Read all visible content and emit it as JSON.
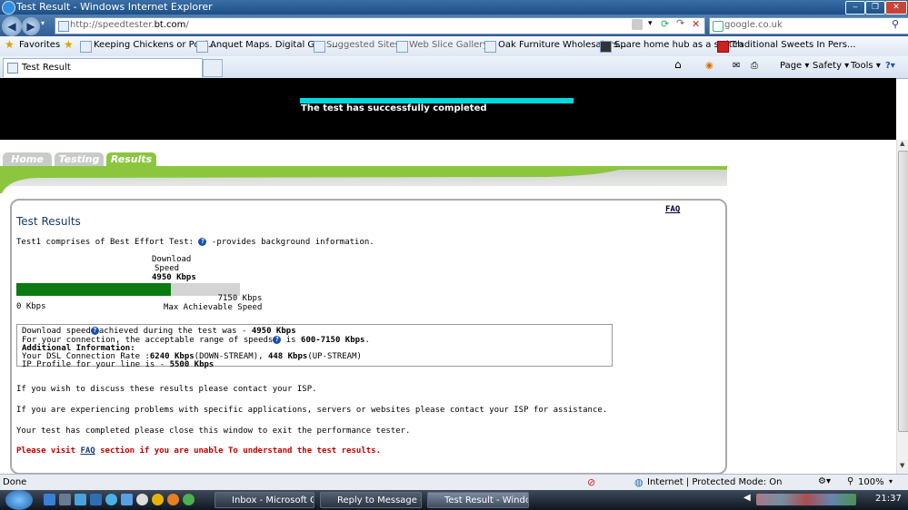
{
  "window": {
    "title": "Test Result - Windows Internet Explorer"
  },
  "address_bar": {
    "url_prefix": "http://speedtester.",
    "url_domain": "bt.com",
    "url_suffix": "/"
  },
  "search_box": {
    "placeholder": "google.co.uk"
  },
  "favorites_bar": {
    "favorites_label": "Favorites",
    "items": [
      {
        "label": "Keeping Chickens or Poul..."
      },
      {
        "label": "Anquet Maps. Digital GPS ..."
      },
      {
        "label": "Suggested Sites ▾"
      },
      {
        "label": "Web Slice Gallery ▾"
      },
      {
        "label": "Oak Furniture Wholesalers..."
      },
      {
        "label": "Spare home hub as a switch"
      },
      {
        "label": "Traditional Sweets In Pers..."
      }
    ]
  },
  "tab_bar": {
    "tab_label": "Test Result",
    "commands": {
      "page": "Page ▾",
      "safety": "Safety ▾",
      "tools": "Tools ▾"
    }
  },
  "page": {
    "banner_message": "The test has successfully completed",
    "nav_tabs": [
      "Home",
      "Testing",
      "Results"
    ],
    "faq_link": "FAQ",
    "title": "Test Results",
    "intro_before": "Test1 comprises of Best Effort Test: ",
    "intro_after": " -provides background information.",
    "download_label_1": "Download",
    "download_label_2": "Speed",
    "download_value": "4950 Kbps",
    "download_fraction": 0.692,
    "zero_label": "0 Kbps",
    "max_value": "7150 Kbps",
    "max_label": "Max Achievable Speed",
    "info": {
      "l1_a": "Download speed",
      "l1_b": "achieved during the test was - ",
      "l1_c": "4950 Kbps",
      "l2_a": "For your connection, the acceptable range of speeds",
      "l2_b": " is ",
      "l2_c": "600-7150 Kbps",
      "l2_d": ".",
      "l3": "Additional Information:",
      "l4_a": "Your DSL Connection Rate :",
      "l4_b": "6240 Kbps",
      "l4_c": "(DOWN-STREAM), ",
      "l4_d": "448 Kbps",
      "l4_e": "(UP-STREAM)",
      "l5_a": "IP Profile for your line is - ",
      "l5_b": "5500 Kbps"
    },
    "para1": "If you wish to discuss these results please contact your ISP.",
    "para2": "If you are experiencing problems with specific applications, servers or websites please contact your ISP for assistance.",
    "para3": "Your test has completed please close this window to exit the performance tester.",
    "visit_a": "Please visit ",
    "visit_faq": "FAQ",
    "visit_b": " section if you are unable To understand the test results."
  },
  "status_bar": {
    "status": "Done",
    "zone": "Internet | Protected Mode: On",
    "zoom": "100%"
  },
  "taskbar": {
    "tasks": [
      {
        "label": "Inbox - Microsoft O..."
      },
      {
        "label": "Reply to Message - ..."
      },
      {
        "label": "Test Result - Windo..."
      }
    ],
    "clock": "21:37"
  },
  "colors": {
    "accent_green": "#8cc63f",
    "bar_green": "#0b7a10",
    "banner_cyan": "#00d8e0",
    "warning_red": "#c00000"
  }
}
